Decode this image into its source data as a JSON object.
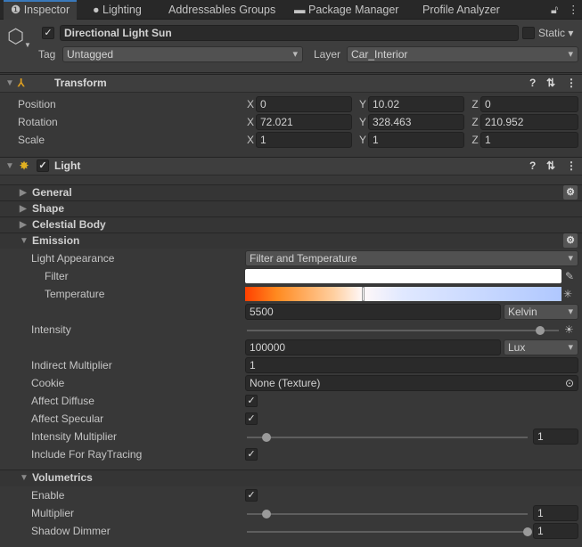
{
  "tabs": [
    {
      "label": "Inspector",
      "icon": "info-icon"
    },
    {
      "label": "Lighting",
      "icon": "bulb-icon"
    },
    {
      "label": "Addressables Groups"
    },
    {
      "label": "Package Manager",
      "icon": "package-icon"
    },
    {
      "label": "Profile Analyzer"
    }
  ],
  "object": {
    "name": "Directional Light Sun",
    "active": true,
    "static_label": "Static",
    "tag_label": "Tag",
    "tag": "Untagged",
    "layer_label": "Layer",
    "layer": "Car_Interior"
  },
  "transform": {
    "title": "Transform",
    "rows": [
      {
        "label": "Position",
        "x": "0",
        "y": "10.02",
        "z": "0"
      },
      {
        "label": "Rotation",
        "x": "72.021",
        "y": "328.463",
        "z": "210.952"
      },
      {
        "label": "Scale",
        "x": "1",
        "y": "1",
        "z": "1"
      }
    ],
    "axes": [
      "X",
      "Y",
      "Z"
    ]
  },
  "light": {
    "title": "Light",
    "enabled": true,
    "sections": {
      "general": "General",
      "shape": "Shape",
      "celestial": "Celestial Body",
      "emission": "Emission",
      "volumetrics": "Volumetrics"
    },
    "emission": {
      "light_appearance_label": "Light Appearance",
      "light_appearance": "Filter and Temperature",
      "filter_label": "Filter",
      "filter_color": "#ffffff",
      "temperature_label": "Temperature",
      "temperature": "5500",
      "temperature_unit": "Kelvin",
      "intensity_label": "Intensity",
      "intensity": "100000",
      "intensity_unit": "Lux",
      "intensity_slider": 0.94,
      "indirect_label": "Indirect Multiplier",
      "indirect": "1",
      "cookie_label": "Cookie",
      "cookie": "None (Texture)",
      "affect_diffuse_label": "Affect Diffuse",
      "affect_diffuse": true,
      "affect_specular_label": "Affect Specular",
      "affect_specular": true,
      "intensity_mult_label": "Intensity Multiplier",
      "intensity_mult": "1",
      "intensity_mult_slider": 0.07,
      "raytracing_label": "Include For RayTracing",
      "raytracing": true
    },
    "volumetrics": {
      "enable_label": "Enable",
      "enable": true,
      "multiplier_label": "Multiplier",
      "multiplier": "1",
      "multiplier_slider": 0.07,
      "shadow_dimmer_label": "Shadow Dimmer",
      "shadow_dimmer": "1",
      "shadow_dimmer_slider": 1.0
    }
  },
  "check": "✓"
}
